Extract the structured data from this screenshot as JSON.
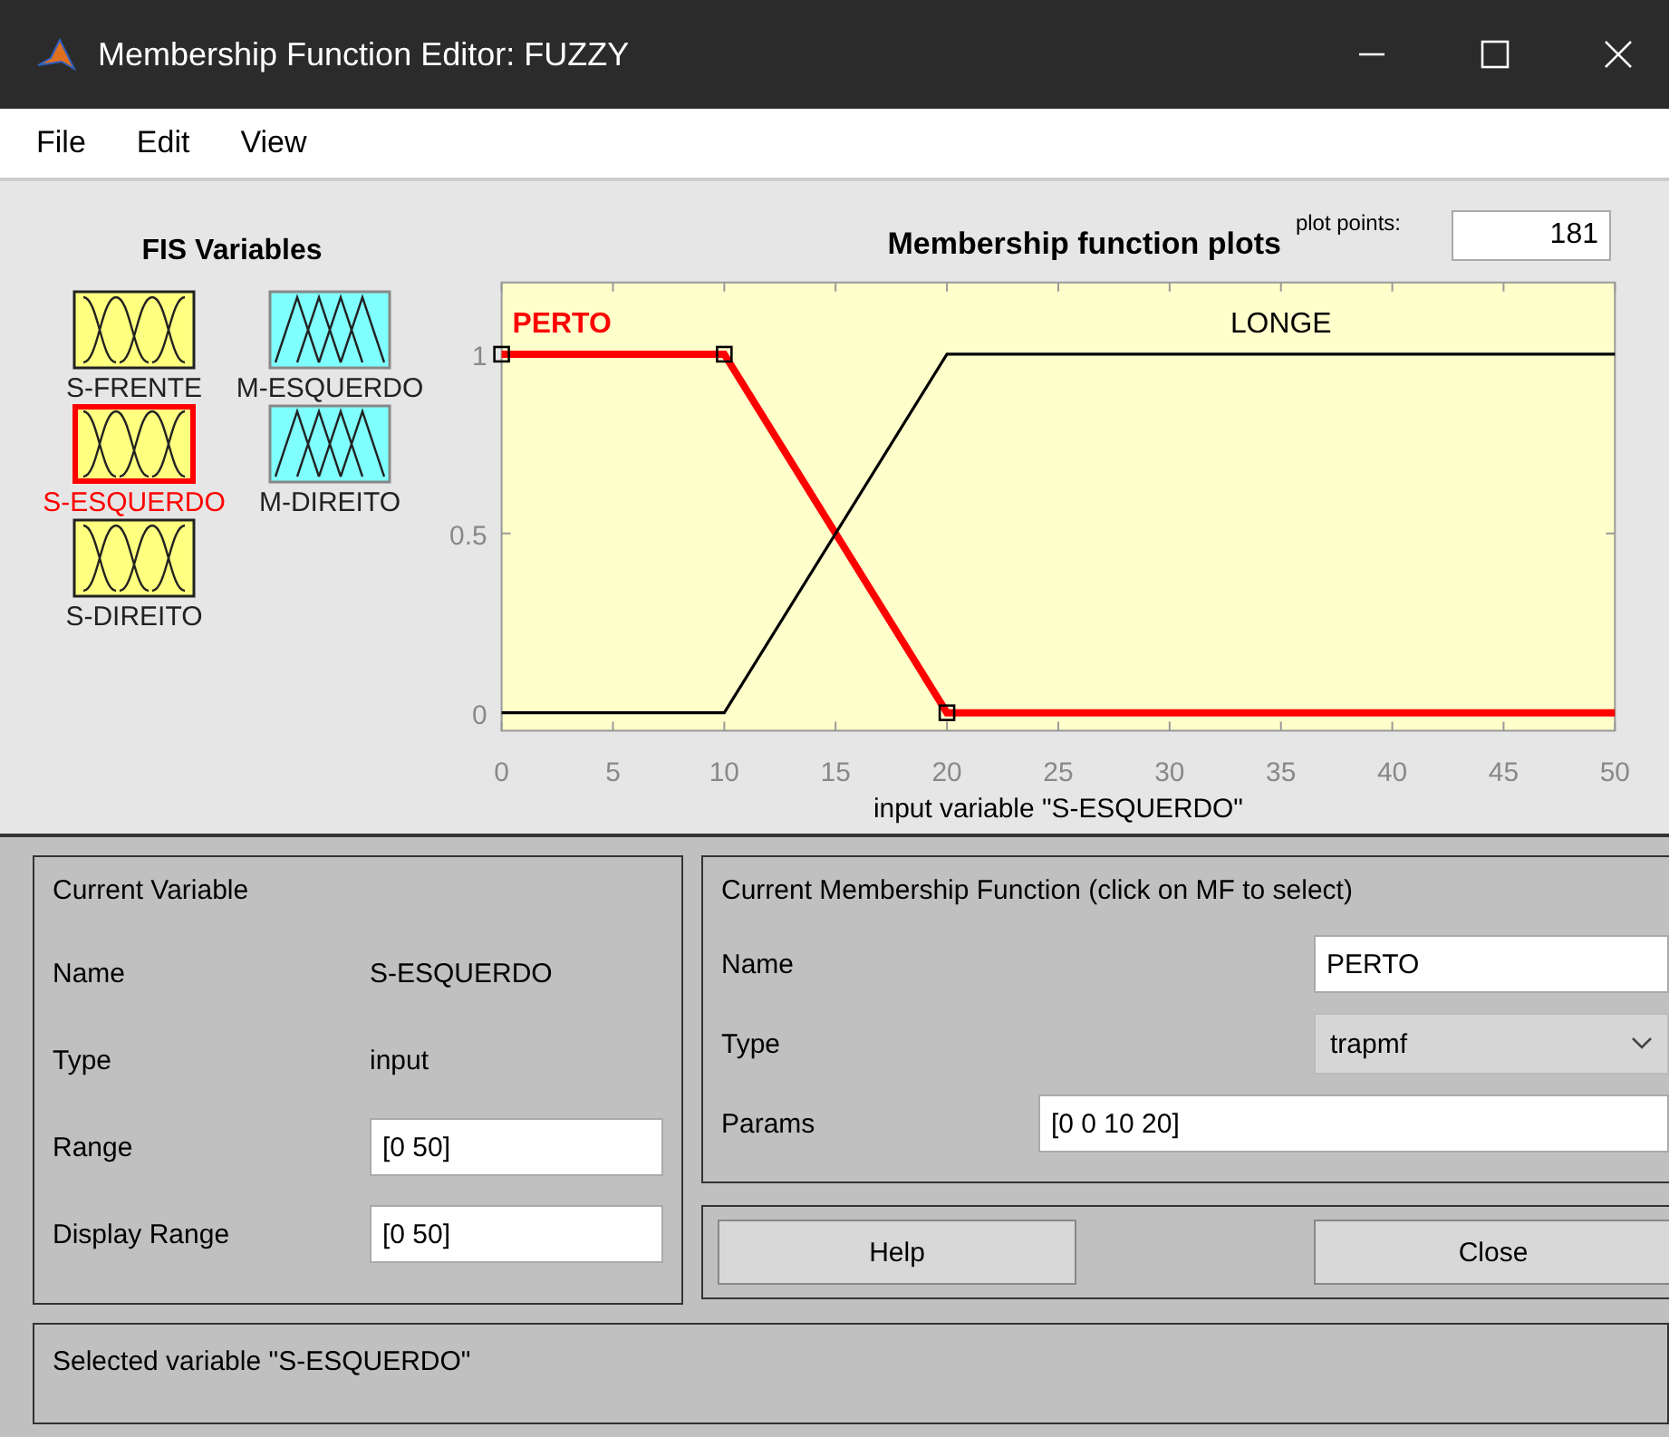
{
  "window": {
    "title": "Membership Function Editor: FUZZY"
  },
  "menu": [
    "File",
    "Edit",
    "View"
  ],
  "fis_variables": {
    "title": "FIS Variables",
    "items": [
      {
        "name": "S-FRENTE",
        "kind": "input",
        "selected": false
      },
      {
        "name": "M-ESQUERDO",
        "kind": "output",
        "selected": false
      },
      {
        "name": "S-ESQUERDO",
        "kind": "input",
        "selected": true
      },
      {
        "name": "M-DIREITO",
        "kind": "output",
        "selected": false
      },
      {
        "name": "S-DIREITO",
        "kind": "input",
        "selected": false
      }
    ]
  },
  "plot": {
    "plot_points_label": "plot points:",
    "plot_points": "181",
    "membership_functions": [
      {
        "name": "PERTO",
        "selected": true
      },
      {
        "name": "LONGE",
        "selected": false
      }
    ],
    "chart_data": {
      "type": "line",
      "title": "Membership function plots",
      "xlabel": "input variable \"S-ESQUERDO\"",
      "x": [
        0,
        10,
        20,
        50
      ],
      "series": [
        {
          "color": "#ff0000",
          "values": [
            1,
            1,
            0,
            0
          ]
        },
        {
          "color": "#000000",
          "values": [
            0,
            0,
            1,
            1
          ]
        }
      ],
      "xlim": [
        0,
        50
      ],
      "ylim": [
        -0.05,
        1.2
      ],
      "xticks": [
        0,
        5,
        10,
        15,
        20,
        25,
        30,
        35,
        40,
        45,
        50
      ],
      "yticks": [
        0,
        {
          "value": 0.5,
          "label": "0.5"
        },
        1
      ]
    }
  },
  "current_variable": {
    "title": "Current Variable",
    "rows": [
      {
        "label": "Name",
        "value": "S-ESQUERDO",
        "kind": "text"
      },
      {
        "label": "Type",
        "value": "input",
        "kind": "text"
      },
      {
        "label": "Range",
        "value": "[0 50]",
        "kind": "field"
      },
      {
        "label": "Display Range",
        "value": "[0 50]",
        "kind": "field"
      }
    ]
  },
  "current_mf": {
    "title": "Current Membership Function (click on MF to select)",
    "name_label": "Name",
    "name": "PERTO",
    "type_label": "Type",
    "type": "trapmf",
    "params_label": "Params",
    "params": "[0 0 10 20]"
  },
  "buttons": [
    "Help",
    "Close"
  ],
  "status": "Selected variable \"S-ESQUERDO\""
}
